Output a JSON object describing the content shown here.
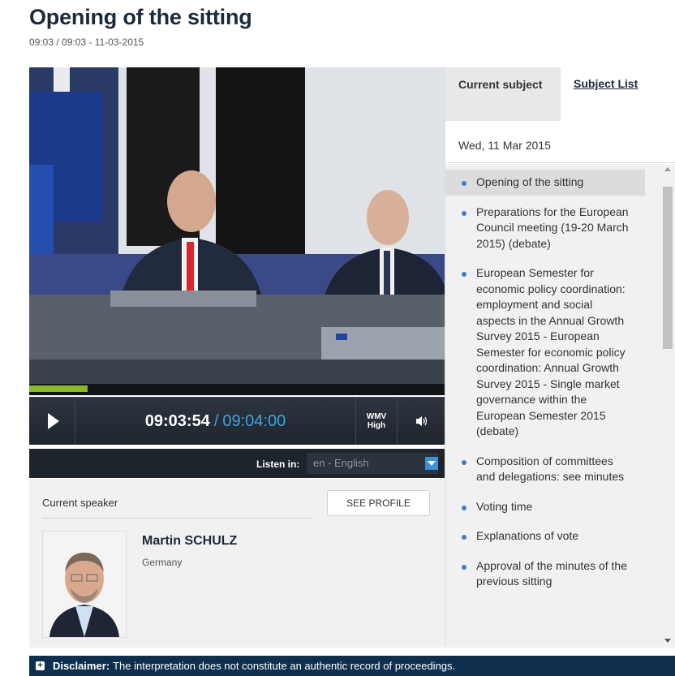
{
  "header": {
    "title": "Opening of the sitting",
    "subtitle": "09:03 / 09:03 - 11-03-2015"
  },
  "player": {
    "progress": 0.14,
    "current_time": "09:03:54",
    "separator": "/",
    "total_time": "09:04:00",
    "quality_line1": "WMV",
    "quality_line2": "High",
    "listen_label": "Listen in:",
    "language": "en - English"
  },
  "speaker": {
    "label": "Current speaker",
    "profile_button": "SEE PROFILE",
    "name": "Martin SCHULZ",
    "country": "Germany"
  },
  "panel": {
    "tab_current": "Current subject",
    "tab_subjects": "Subject List",
    "date": "Wed, 11 Mar 2015",
    "items": [
      {
        "label": "Opening of the sitting"
      },
      {
        "label": "Preparations for the European Council meeting (19-20 March 2015) (debate)"
      },
      {
        "label": "European Semester for economic policy coordination: employment and social aspects in the Annual Growth Survey 2015 - European Semester for economic policy coordination: Annual Growth Survey 2015 - Single market governance within the European Semester 2015 (debate)"
      },
      {
        "label": "Composition of committees and delegations: see minutes"
      },
      {
        "label": "Voting time"
      },
      {
        "label": "Explanations of vote"
      },
      {
        "label": "Approval of the minutes of the previous sitting"
      }
    ]
  },
  "disclaimer": {
    "label": "Disclaimer:",
    "text": "The interpretation does not constitute an authentic record of proceedings."
  },
  "colors": {
    "accent_blue": "#3da4e3",
    "progress_green": "#8bb826",
    "disclaimer_bg": "#0f2f4e"
  }
}
